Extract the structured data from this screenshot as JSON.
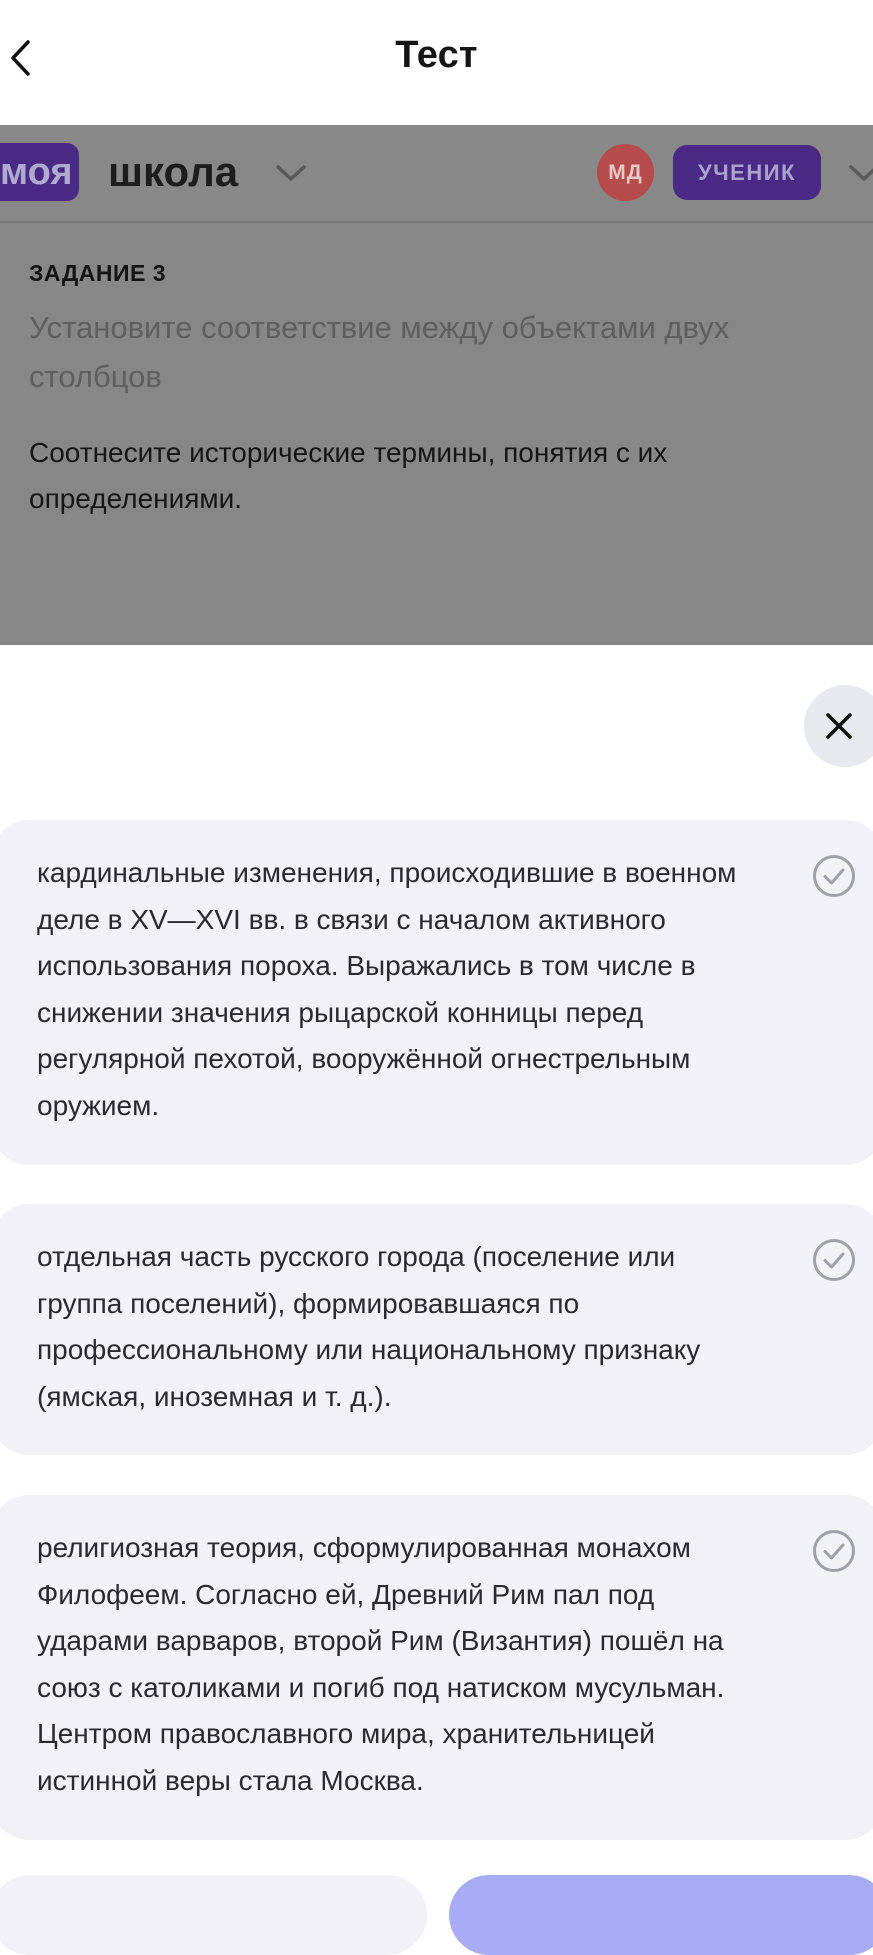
{
  "header": {
    "title": "Тест",
    "back_icon": "chevron-left-icon"
  },
  "background_page": {
    "logo": {
      "highlight": "моя",
      "word": "школа"
    },
    "avatar_initials": "МД",
    "role_badge": "УЧЕНИК",
    "task": {
      "label": "ЗАДАНИЕ 3",
      "subtitle": "Установите соответствие между объектами двух столбцов",
      "instruction": "Соотнесите исторические термины, понятия с их определениями."
    }
  },
  "sheet": {
    "close_icon": "close-icon",
    "definitions": [
      {
        "text": "кардинальные изменения, происходившие в военном деле в XV—XVI вв. в связи с началом активного использования пороха. Выражались в том числе в снижении значения рыцарской конницы перед регулярной пехотой, вооружённой огнестрельным оружием.",
        "icon": "check-circle-icon"
      },
      {
        "text": "отдельная часть русского города (поселение или группа поселений), формировавшаяся по профессиональному или национальному признаку (ямская, иноземная и т. д.).",
        "icon": "check-circle-icon"
      },
      {
        "text": "религиозная теория, сформулированная монахом Филофеем. Согласно ей, Древний Рим пал под ударами варваров, второй Рим (Византия) пошёл на союз с католиками и погиб под натиском мусульман. Центром православного мира, хранительницей истинной веры стала Москва.",
        "icon": "check-circle-icon"
      }
    ]
  },
  "colors": {
    "accent": "#a7acf4",
    "card_bg": "#f1f1f6",
    "overlay_bg": "#878787",
    "brand_purple_dimmed": "#4a2a84",
    "avatar_red_dimmed": "#b54b4b"
  }
}
